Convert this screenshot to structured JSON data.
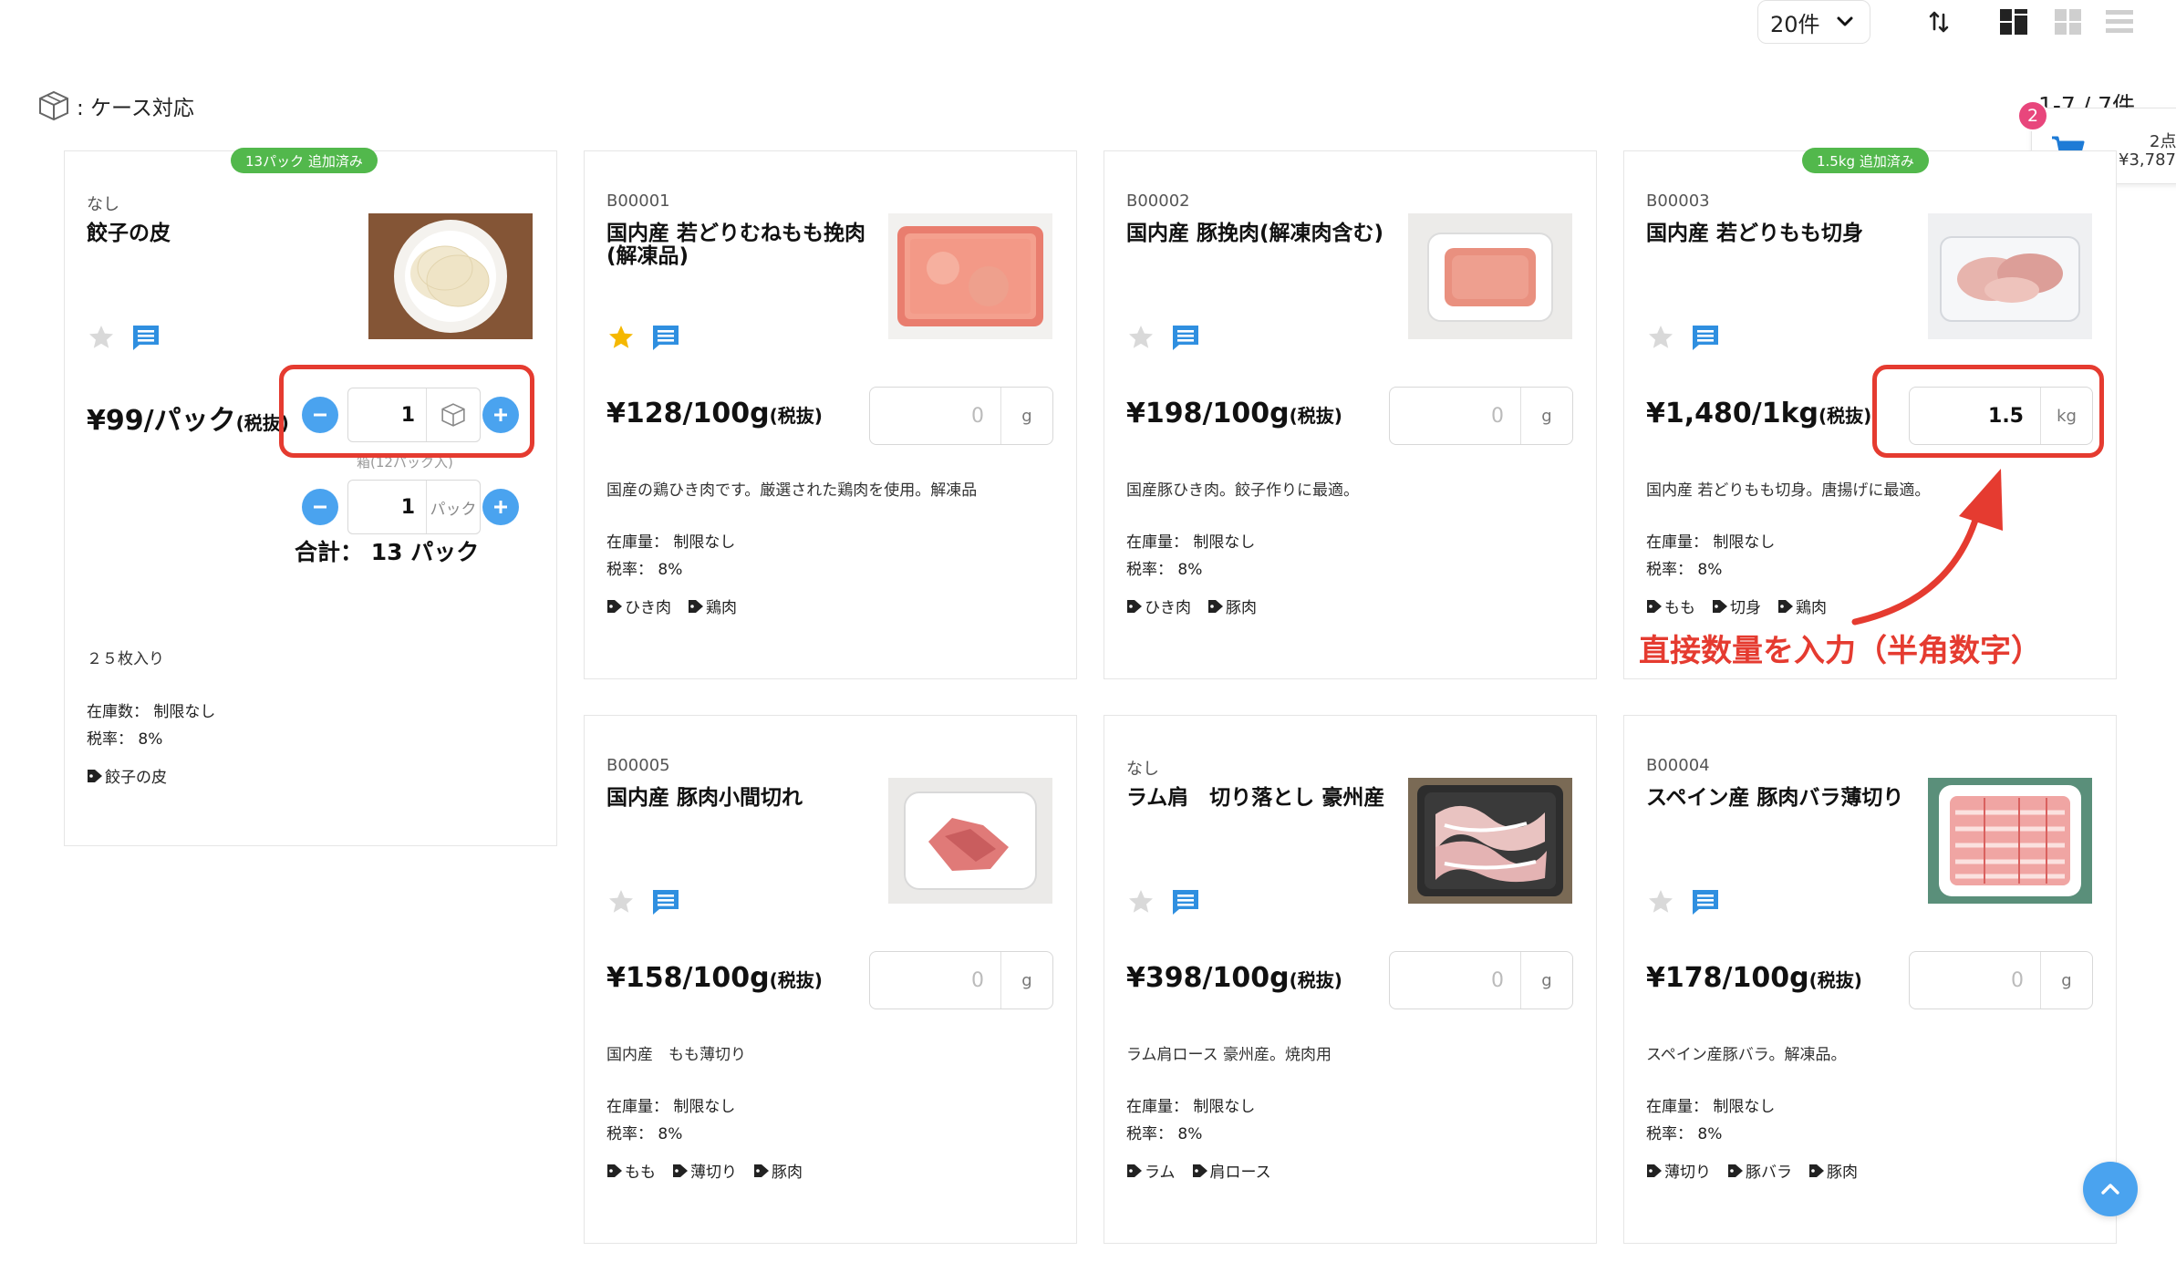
{
  "toolbar": {
    "per_page": "20件",
    "sort_icon": "sort-arrows-icon",
    "view_icons": [
      "split-view-icon",
      "grid-view-icon",
      "list-view-icon"
    ]
  },
  "legend": {
    "icon": "box-icon",
    "label": ": ケース対応"
  },
  "result_count": "1-7 / 7件",
  "cart": {
    "badge": "2",
    "points": "2点",
    "total": "¥3,787"
  },
  "products": [
    {
      "code": "なし",
      "name": "餃子の皮",
      "price": "¥99/パック",
      "tax_note": "(税抜)",
      "added_badge": "13パック 追加済み",
      "favorite": false,
      "case_qty": "1",
      "case_hint": "箱(12パック入)",
      "pack_qty": "1",
      "pack_unit": "パック",
      "total": "合計： 13 パック",
      "desc": "２５枚入り",
      "stock": "在庫数： 制限なし",
      "tax_rate": "税率： 8%",
      "tags": [
        "餃子の皮"
      ]
    },
    {
      "code": "B00001",
      "name": "国内産 若どりむねもも挽肉(解凍品)",
      "price": "¥128/100g",
      "tax_note": "(税抜)",
      "favorite": true,
      "qty": "0",
      "unit": "g",
      "desc": "国産の鶏ひき肉です。厳選された鶏肉を使用。解凍品",
      "stock": "在庫量： 制限なし",
      "tax_rate": "税率： 8%",
      "tags": [
        "ひき肉",
        "鶏肉"
      ]
    },
    {
      "code": "B00002",
      "name": "国内産 豚挽肉(解凍肉含む)",
      "price": "¥198/100g",
      "tax_note": "(税抜)",
      "favorite": false,
      "qty": "0",
      "unit": "g",
      "desc": "国産豚ひき肉。餃子作りに最適。",
      "stock": "在庫量： 制限なし",
      "tax_rate": "税率： 8%",
      "tags": [
        "ひき肉",
        "豚肉"
      ]
    },
    {
      "code": "B00003",
      "name": "国内産 若どりもも切身",
      "price": "¥1,480/1kg",
      "tax_note": "(税抜)",
      "added_badge": "1.5kg 追加済み",
      "favorite": false,
      "qty": "1.5",
      "unit": "kg",
      "desc": "国内産 若どりもも切身。唐揚げに最適。",
      "stock": "在庫量： 制限なし",
      "tax_rate": "税率： 8%",
      "tags": [
        "もも",
        "切身",
        "鶏肉"
      ]
    },
    {
      "code": "B00005",
      "name": "国内産 豚肉小間切れ",
      "price": "¥158/100g",
      "tax_note": "(税抜)",
      "favorite": false,
      "qty": "0",
      "unit": "g",
      "desc": "国内産　もも薄切り",
      "stock": "在庫量： 制限なし",
      "tax_rate": "税率： 8%",
      "tags": [
        "もも",
        "薄切り",
        "豚肉"
      ]
    },
    {
      "code": "なし",
      "name": "ラム肩　切り落とし 豪州産",
      "price": "¥398/100g",
      "tax_note": "(税抜)",
      "favorite": false,
      "qty": "0",
      "unit": "g",
      "desc": "ラム肩ロース 豪州産。焼肉用",
      "stock": "在庫量： 制限なし",
      "tax_rate": "税率： 8%",
      "tags": [
        "ラム",
        "肩ロース"
      ]
    },
    {
      "code": "B00004",
      "name": "スペイン産 豚肉バラ薄切り",
      "price": "¥178/100g",
      "tax_note": "(税抜)",
      "favorite": false,
      "qty": "0",
      "unit": "g",
      "desc": "スペイン産豚バラ。解凍品。",
      "stock": "在庫量： 制限なし",
      "tax_rate": "税率： 8%",
      "tags": [
        "薄切り",
        "豚バラ",
        "豚肉"
      ]
    }
  ],
  "annotation": "直接数量を入力（半角数字）",
  "colors": {
    "accent_blue": "#4aa3ef",
    "annotation_red": "#e53b30",
    "added_green": "#52b84c",
    "badge_pink": "#e8467c",
    "favorite_gold": "#f5b800"
  }
}
